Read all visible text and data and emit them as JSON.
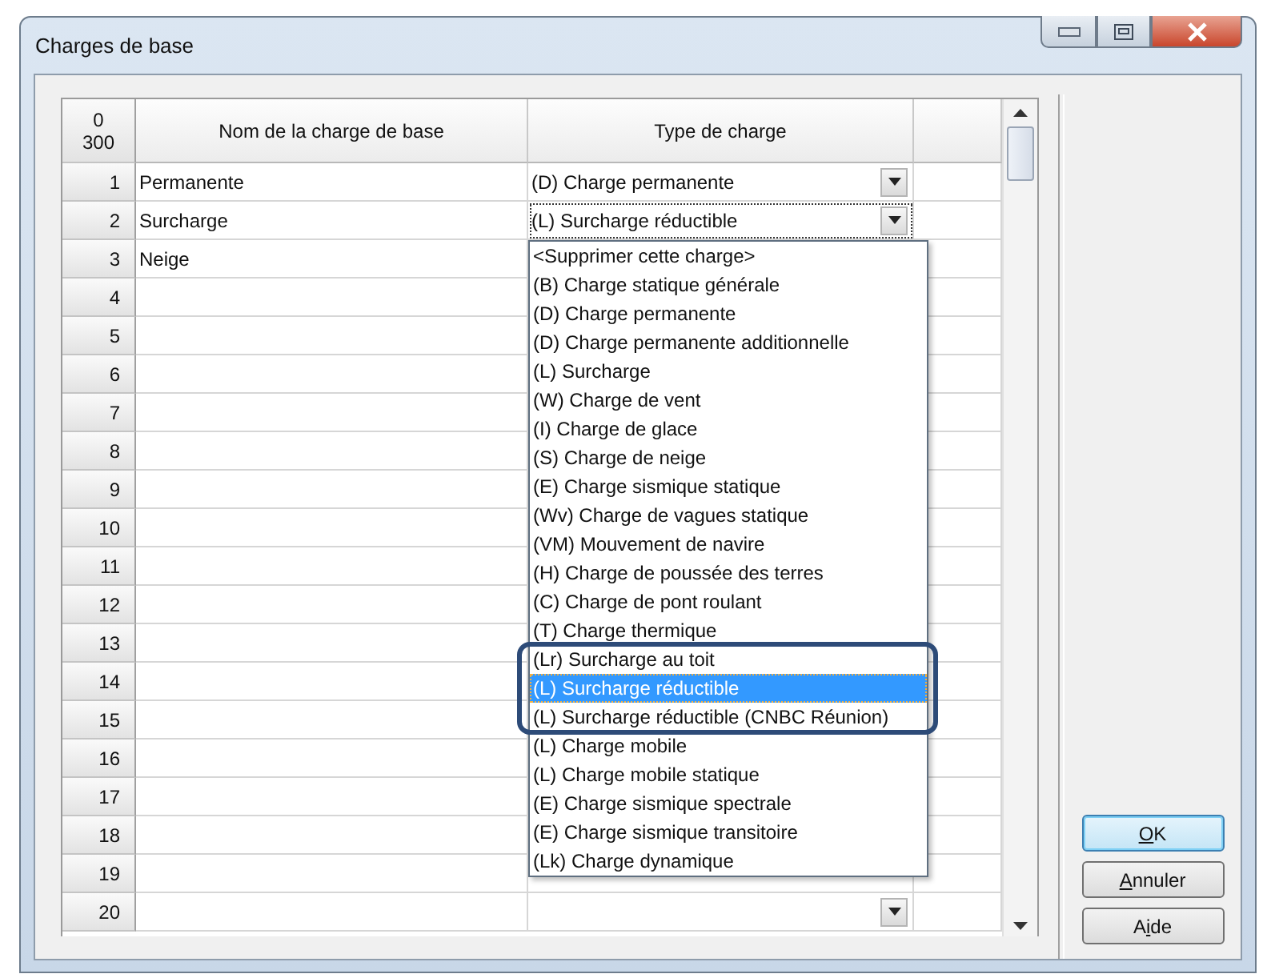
{
  "window": {
    "title": "Charges de base"
  },
  "table": {
    "corner": [
      "0",
      "300"
    ],
    "columns": [
      "Nom de la charge de base",
      "Type de charge"
    ],
    "rows": [
      {
        "number": "1",
        "name": "Permanente",
        "type": "(D)  Charge permanente",
        "dropdown_button": true,
        "focused": false
      },
      {
        "number": "2",
        "name": "Surcharge",
        "type": "(L)  Surcharge réductible",
        "dropdown_button": true,
        "focused": true
      },
      {
        "number": "3",
        "name": "Neige"
      },
      {
        "number": "4"
      },
      {
        "number": "5"
      },
      {
        "number": "6"
      },
      {
        "number": "7"
      },
      {
        "number": "8"
      },
      {
        "number": "9"
      },
      {
        "number": "10"
      },
      {
        "number": "11"
      },
      {
        "number": "12"
      },
      {
        "number": "13"
      },
      {
        "number": "14"
      },
      {
        "number": "15"
      },
      {
        "number": "16"
      },
      {
        "number": "17"
      },
      {
        "number": "18"
      },
      {
        "number": "19",
        "dropdown_button": false,
        "focused": false
      },
      {
        "number": "20",
        "dropdown_button": true,
        "focused": false
      }
    ]
  },
  "dropdown": {
    "items": [
      {
        "label": "<Supprimer cette charge>",
        "selected": false,
        "annotated": false
      },
      {
        "label": "(B)  Charge statique générale",
        "selected": false,
        "annotated": false
      },
      {
        "label": "(D)  Charge permanente",
        "selected": false,
        "annotated": false
      },
      {
        "label": "(D)  Charge permanente additionnelle",
        "selected": false,
        "annotated": false
      },
      {
        "label": "(L)  Surcharge",
        "selected": false,
        "annotated": false
      },
      {
        "label": "(W)  Charge de vent",
        "selected": false,
        "annotated": false
      },
      {
        "label": "(I)  Charge de glace",
        "selected": false,
        "annotated": false
      },
      {
        "label": "(S)  Charge de neige",
        "selected": false,
        "annotated": false
      },
      {
        "label": "(E)  Charge sismique statique",
        "selected": false,
        "annotated": false
      },
      {
        "label": "(Wv) Charge de vagues statique",
        "selected": false,
        "annotated": false
      },
      {
        "label": "(VM) Mouvement de navire",
        "selected": false,
        "annotated": false
      },
      {
        "label": "(H)  Charge de poussée des terres",
        "selected": false,
        "annotated": false
      },
      {
        "label": "(C)  Charge de pont roulant",
        "selected": false,
        "annotated": false
      },
      {
        "label": "(T)  Charge thermique",
        "selected": false,
        "annotated": false
      },
      {
        "label": "(Lr) Surcharge au toit",
        "selected": false,
        "annotated": true
      },
      {
        "label": "(L)  Surcharge réductible",
        "selected": true,
        "annotated": true
      },
      {
        "label": "(L)  Surcharge réductible (CNBC Réunion)",
        "selected": false,
        "annotated": true
      },
      {
        "label": "(L)  Charge mobile",
        "selected": false,
        "annotated": false
      },
      {
        "label": "(L)  Charge mobile statique",
        "selected": false,
        "annotated": false
      },
      {
        "label": "(E)  Charge sismique spectrale",
        "selected": false,
        "annotated": false
      },
      {
        "label": "(E)  Charge sismique transitoire",
        "selected": false,
        "annotated": false
      },
      {
        "label": "(Lk) Charge dynamique",
        "selected": false,
        "annotated": false
      }
    ]
  },
  "buttons": [
    {
      "mnemonic": "O",
      "after": "K",
      "default": true
    },
    {
      "mnemonic": "A",
      "after": "nnuler",
      "default": false
    },
    {
      "before": "A",
      "mnemonic": "i",
      "after": "de",
      "default": false
    }
  ]
}
